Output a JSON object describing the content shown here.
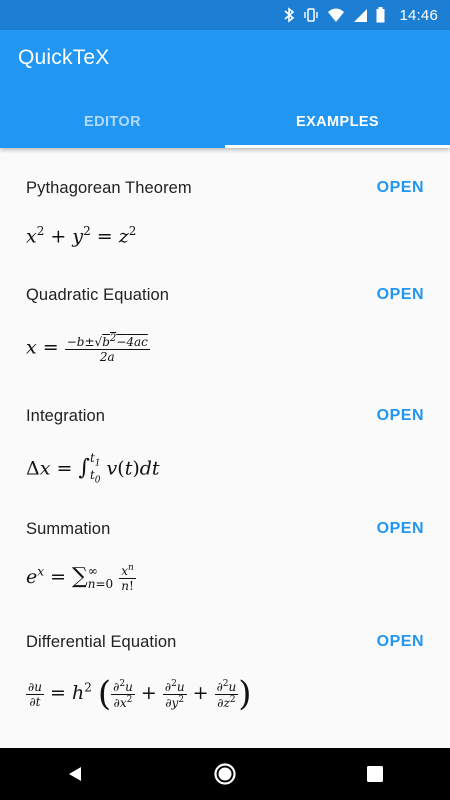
{
  "status": {
    "time": "14:46"
  },
  "app": {
    "title": "QuickTeX"
  },
  "tabs": [
    {
      "label": "EDITOR"
    },
    {
      "label": "EXAMPLES"
    }
  ],
  "examples": [
    {
      "title": "Pythagorean Theorem",
      "action": "OPEN"
    },
    {
      "title": "Quadratic Equation",
      "action": "OPEN"
    },
    {
      "title": "Integration",
      "action": "OPEN"
    },
    {
      "title": "Summation",
      "action": "OPEN"
    },
    {
      "title": "Differential Equation",
      "action": "OPEN"
    }
  ],
  "colors": {
    "primary": "#2196f3",
    "status_bar": "#1d7fd4",
    "accent_text": "#2196f3"
  },
  "icons": [
    "bluetooth-icon",
    "vibrate-icon",
    "wifi-icon",
    "signal-icon",
    "battery-icon",
    "back-icon",
    "home-icon",
    "recents-icon"
  ]
}
